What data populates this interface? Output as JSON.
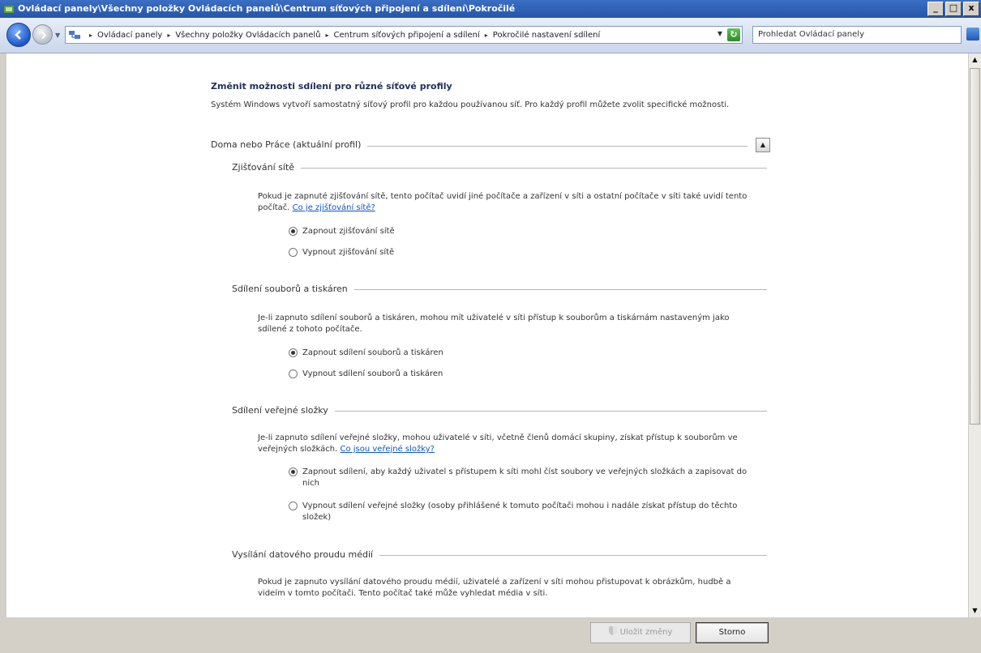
{
  "window": {
    "title": "Ovládací panely\\Všechny položky Ovládacích panelů\\Centrum síťových připojení a sdílení\\Pokročilé",
    "buttons": {
      "minimize": "_",
      "maximize": "□",
      "close": "x"
    }
  },
  "nav": {
    "breadcrumbs": [
      "Ovládací panely",
      "Všechny položky Ovládacích panelů",
      "Centrum síťových připojení a sdílení",
      "Pokročilé nastavení sdílení"
    ],
    "search_placeholder": "Prohledat Ovládací panely"
  },
  "page": {
    "heading": "Změnit možnosti sdílení pro různé síťové profily",
    "intro": "Systém Windows vytvoří samostatný síťový profil pro každou používanou síť. Pro každý profil můžete zvolit specifické možnosti.",
    "profile_label": "Doma nebo Práce (aktuální profil)",
    "sections": [
      {
        "title": "Zjišťování sítě",
        "description": "Pokud je zapnuté zjišťování sítě, tento počítač uvidí jiné počítače a zařízení v síti a ostatní počítače v síti také uvidí tento počítač.",
        "link": "Co je zjišťování sítě?",
        "options": [
          {
            "label": "Zapnout zjišťování sítě",
            "selected": true
          },
          {
            "label": "Vypnout zjišťování sítě",
            "selected": false
          }
        ]
      },
      {
        "title": "Sdílení souborů a tiskáren",
        "description": "Je-li zapnuto sdílení souborů a tiskáren, mohou mít uživatelé v síti přístup k souborům a tiskárnám nastaveným jako sdílené z tohoto počítače.",
        "link": "",
        "options": [
          {
            "label": "Zapnout sdílení souborů a tiskáren",
            "selected": true
          },
          {
            "label": "Vypnout sdílení souborů a tiskáren",
            "selected": false
          }
        ]
      },
      {
        "title": "Sdílení veřejné složky",
        "description": "Je-li zapnuto sdílení veřejné složky, mohou uživatelé v síti, včetně členů domácí skupiny, získat přístup k souborům ve veřejných složkách.",
        "link": "Co jsou veřejné složky?",
        "options": [
          {
            "label": "Zapnout sdílení, aby každý uživatel s přístupem k síti mohl číst soubory ve veřejných složkách a zapisovat do nich",
            "selected": true
          },
          {
            "label": "Vypnout sdílení veřejné složky (osoby přihlášené k tomuto počítači mohou i nadále získat přístup do těchto složek)",
            "selected": false
          }
        ]
      },
      {
        "title": "Vysílání datového proudu médií",
        "description": "Pokud je zapnuto vysílání datového proudu médií, uživatelé a zařízení v síti mohou přistupovat k obrázkům, hudbě a videím v tomto počítači. Tento počítač také může vyhledat média v síti.",
        "link": "",
        "options": []
      }
    ]
  },
  "footer": {
    "save_label": "Uložit změny",
    "cancel_label": "Storno"
  },
  "colors": {
    "title_bar": "#2655a8",
    "link": "#0b55c4",
    "heading": "#1e2f5a"
  }
}
